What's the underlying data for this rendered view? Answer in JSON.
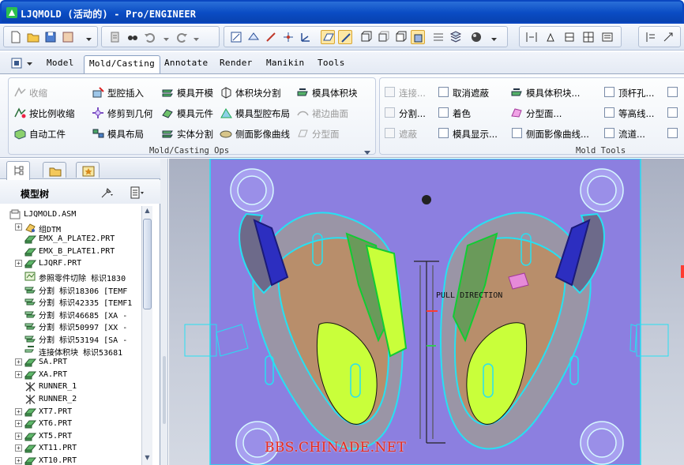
{
  "window": {
    "title": "LJQMOLD (活动的) - Pro/ENGINEER"
  },
  "toolbar": {
    "icons": [
      "new-icon",
      "open-icon",
      "save-icon",
      "print-icon",
      "regenerate-icon",
      "find-icon",
      "undo-icon",
      "redo-icon",
      "sketch-icon",
      "datum-icon",
      "axis-icon",
      "point-icon",
      "csys-icon",
      "plane-display-icon",
      "axis-display-icon",
      "wireframe-icon",
      "hidden-line-icon",
      "no-hidden-icon",
      "shaded-icon",
      "spin-center-icon",
      "appearance-icon",
      "zoom-in-icon",
      "zoom-out-icon",
      "refit-icon",
      "view-icon",
      "layers-icon",
      "help-icon"
    ]
  },
  "menu": {
    "tabs": [
      "Model",
      "Mold/Casting",
      "Annotate",
      "Render",
      "Manikin",
      "Tools"
    ],
    "active": "Mold/Casting"
  },
  "ribbon": {
    "ops": {
      "caption": "Mold/Casting Ops",
      "col1": [
        "收缩",
        "按比例收缩",
        "自动工件"
      ],
      "col2": [
        "型腔插入",
        "修剪到几何",
        "模具布局"
      ],
      "col3": [
        "模具开模",
        "模具元件",
        "实体分割"
      ],
      "col4": [
        "体积块分割",
        "模具型腔布局",
        "侧面影像曲线"
      ],
      "col5": [
        "模具体积块",
        "裙边曲面",
        "分型面"
      ]
    },
    "tools": {
      "caption": "Mold Tools",
      "col1": [
        "连接...",
        "分割...",
        "遮蔽"
      ],
      "col2": [
        "取消遮蔽",
        "着色",
        "模具显示..."
      ],
      "col3": [
        "模具体积块...",
        "分型面...",
        "侧面影像曲线..."
      ],
      "col4": [
        "顶杆孔...",
        "等高线...",
        "流道..."
      ]
    }
  },
  "model_tree": {
    "title": "模型树",
    "items": [
      {
        "label": "LJQMOLD.ASM",
        "icon": "assembly-icon",
        "indent": 0,
        "expander": ""
      },
      {
        "label": "组DTM",
        "icon": "group-icon",
        "indent": 1,
        "expander": "+"
      },
      {
        "label": "EMX_A_PLATE2.PRT",
        "icon": "part-icon",
        "indent": 1,
        "expander": ""
      },
      {
        "label": "EMX_B_PLATE1.PRT",
        "icon": "part-icon",
        "indent": 1,
        "expander": ""
      },
      {
        "label": "LJQRF.PRT",
        "icon": "part-icon",
        "indent": 1,
        "expander": "+"
      },
      {
        "label": "参照零件切除 标识1830",
        "icon": "cut-feature-icon",
        "indent": 1,
        "expander": ""
      },
      {
        "label": "分割 标识18306 [TEMF",
        "icon": "split-feature-icon",
        "indent": 1,
        "expander": ""
      },
      {
        "label": "分割 标识42335 [TEMF1",
        "icon": "split-feature-icon",
        "indent": 1,
        "expander": ""
      },
      {
        "label": "分割 标识46685 [XA -",
        "icon": "split-feature-icon",
        "indent": 1,
        "expander": ""
      },
      {
        "label": "分割 标识50997 [XX -",
        "icon": "split-feature-icon",
        "indent": 1,
        "expander": ""
      },
      {
        "label": "分割 标识53194 [SA -",
        "icon": "split-feature-icon",
        "indent": 1,
        "expander": ""
      },
      {
        "label": "连接体积块 标识53681",
        "icon": "merge-volume-icon",
        "indent": 1,
        "expander": ""
      },
      {
        "label": "SA.PRT",
        "icon": "part-icon",
        "indent": 1,
        "expander": "+"
      },
      {
        "label": "XA.PRT",
        "icon": "part-icon",
        "indent": 1,
        "expander": "+"
      },
      {
        "label": "RUNNER_1",
        "icon": "runner-icon",
        "indent": 1,
        "expander": ""
      },
      {
        "label": "RUNNER_2",
        "icon": "runner-icon",
        "indent": 1,
        "expander": ""
      },
      {
        "label": "XT7.PRT",
        "icon": "part-icon",
        "indent": 1,
        "expander": "+"
      },
      {
        "label": "XT6.PRT",
        "icon": "part-icon",
        "indent": 1,
        "expander": "+"
      },
      {
        "label": "XT5.PRT",
        "icon": "part-icon",
        "indent": 1,
        "expander": "+"
      },
      {
        "label": "XT11.PRT",
        "icon": "part-icon",
        "indent": 1,
        "expander": "+"
      },
      {
        "label": "XT10.PRT",
        "icon": "part-icon",
        "indent": 1,
        "expander": "+"
      }
    ]
  },
  "viewport": {
    "pull_direction_label": "PULL DIRECTION",
    "watermark": "BBS.CHINADE.NET",
    "colors": {
      "plate": "#8c7fe0",
      "highlight": "#20e8f0",
      "wire_green": "#c9ff3a"
    }
  },
  "colors": {
    "titlebar": "#0a4cc4",
    "accent": "#fde7a4"
  }
}
